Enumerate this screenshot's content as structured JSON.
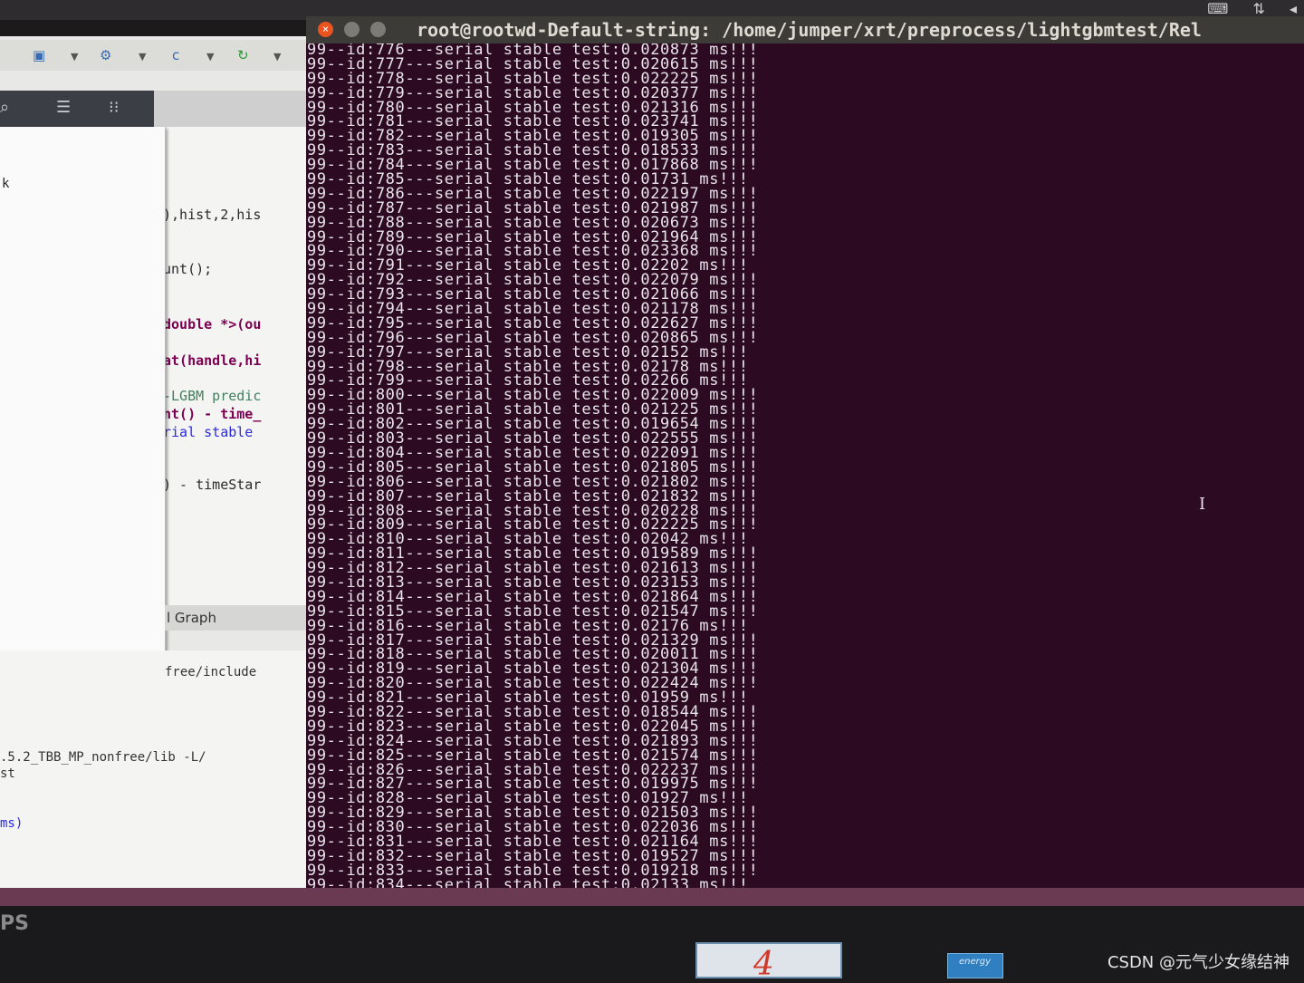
{
  "terminal": {
    "title": "root@rootwd-Default-string: /home/jumper/xrt/preprocess/lightgbmtest/Rel",
    "lines": [
      "99--id:776---serial stable test:0.020873 ms!!!",
      "99--id:777---serial stable test:0.020615 ms!!!",
      "99--id:778---serial stable test:0.022225 ms!!!",
      "99--id:779---serial stable test:0.020377 ms!!!",
      "99--id:780---serial stable test:0.021316 ms!!!",
      "99--id:781---serial stable test:0.023741 ms!!!",
      "99--id:782---serial stable test:0.019305 ms!!!",
      "99--id:783---serial stable test:0.018533 ms!!!",
      "99--id:784---serial stable test:0.017868 ms!!!",
      "99--id:785---serial stable test:0.01731 ms!!!",
      "99--id:786---serial stable test:0.022197 ms!!!",
      "99--id:787---serial stable test:0.021987 ms!!!",
      "99--id:788---serial stable test:0.020673 ms!!!",
      "99--id:789---serial stable test:0.021964 ms!!!",
      "99--id:790---serial stable test:0.023368 ms!!!",
      "99--id:791---serial stable test:0.02202 ms!!!",
      "99--id:792---serial stable test:0.022079 ms!!!",
      "99--id:793---serial stable test:0.021066 ms!!!",
      "99--id:794---serial stable test:0.021178 ms!!!",
      "99--id:795---serial stable test:0.022627 ms!!!",
      "99--id:796---serial stable test:0.020865 ms!!!",
      "99--id:797---serial stable test:0.02152 ms!!!",
      "99--id:798---serial stable test:0.02178 ms!!!",
      "99--id:799---serial stable test:0.02266 ms!!!",
      "99--id:800---serial stable test:0.022009 ms!!!",
      "99--id:801---serial stable test:0.021225 ms!!!",
      "99--id:802---serial stable test:0.019654 ms!!!",
      "99--id:803---serial stable test:0.022555 ms!!!",
      "99--id:804---serial stable test:0.022091 ms!!!",
      "99--id:805---serial stable test:0.021805 ms!!!",
      "99--id:806---serial stable test:0.021802 ms!!!",
      "99--id:807---serial stable test:0.021832 ms!!!",
      "99--id:808---serial stable test:0.020228 ms!!!",
      "99--id:809---serial stable test:0.022225 ms!!!",
      "99--id:810---serial stable test:0.02042 ms!!!",
      "99--id:811---serial stable test:0.019589 ms!!!",
      "99--id:812---serial stable test:0.021613 ms!!!",
      "99--id:813---serial stable test:0.023153 ms!!!",
      "99--id:814---serial stable test:0.021864 ms!!!",
      "99--id:815---serial stable test:0.021547 ms!!!",
      "99--id:816---serial stable test:0.02176 ms!!!",
      "99--id:817---serial stable test:0.021329 ms!!!",
      "99--id:818---serial stable test:0.020011 ms!!!",
      "99--id:819---serial stable test:0.021304 ms!!!",
      "99--id:820---serial stable test:0.022424 ms!!!",
      "99--id:821---serial stable test:0.01959 ms!!!",
      "99--id:822---serial stable test:0.018544 ms!!!",
      "99--id:823---serial stable test:0.022045 ms!!!",
      "99--id:824---serial stable test:0.021893 ms!!!",
      "99--id:825---serial stable test:0.021574 ms!!!",
      "99--id:826---serial stable test:0.022237 ms!!!",
      "99--id:827---serial stable test:0.019975 ms!!!",
      "99--id:828---serial stable test:0.01927 ms!!!",
      "99--id:829---serial stable test:0.021503 ms!!!",
      "99--id:830---serial stable test:0.022036 ms!!!",
      "99--id:831---serial stable test:0.021164 ms!!!",
      "99--id:832---serial stable test:0.019527 ms!!!",
      "99--id:833---serial stable test:0.019218 ms!!!",
      "99--id:834---serial stable test:0.02133 ms!!!"
    ],
    "close_glyph": "×"
  },
  "system_tray": {
    "keyboard_icon": "⌨",
    "network_icon": "⇅",
    "extra_icon": "◂"
  },
  "ide": {
    "popup_text": "k",
    "code_lines": [
      "),hist,2,his",
      "unt();",
      "double *>(ou",
      "at(handle,hi",
      "-LGBM predic",
      "nt() - time_",
      "rial stable",
      ") - timeStar"
    ],
    "graph_tab": "l Graph",
    "console_lines": [
      "free/include",
      ".5.2_TBB_MP_nonfree/lib -L/",
      "st",
      "ms)"
    ],
    "toolbar_icons": {
      "icon1": "▣",
      "icon2": "⚙",
      "icon3": "c",
      "icon4": "↻",
      "arrow": "▼",
      "search": "⌕",
      "list": "☰",
      "grid": "⁝⁝"
    }
  },
  "bezel": {
    "brand": "PS",
    "sticker_number": "4",
    "energy_text": "energy"
  },
  "watermark": "CSDN @元气少女缘结神"
}
